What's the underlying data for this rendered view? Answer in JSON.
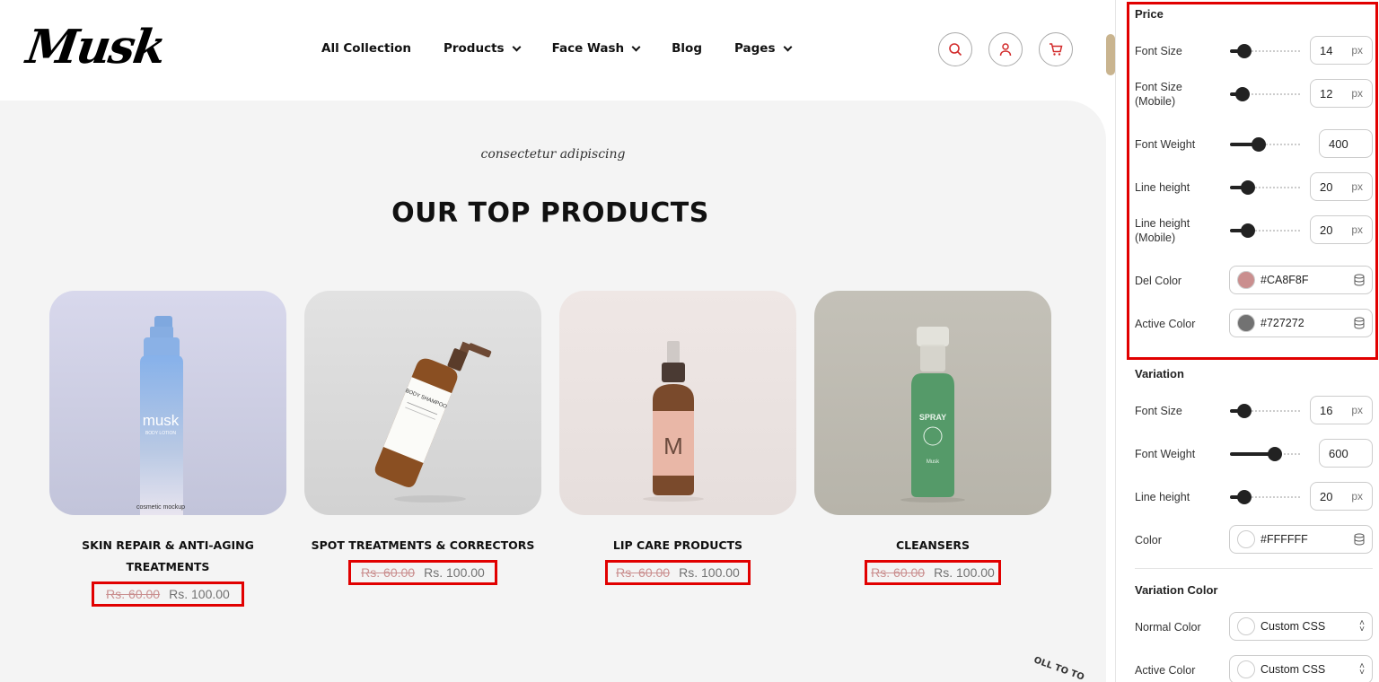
{
  "store": {
    "logo": "Musk",
    "nav": [
      {
        "label": "All Collection",
        "has_dropdown": false
      },
      {
        "label": "Products",
        "has_dropdown": true
      },
      {
        "label": "Face Wash",
        "has_dropdown": true
      },
      {
        "label": "Blog",
        "has_dropdown": false
      },
      {
        "label": "Pages",
        "has_dropdown": true
      }
    ],
    "header_icons": [
      "search-icon",
      "user-icon",
      "cart-icon"
    ],
    "section_subtitle": "consectetur adipiscing",
    "section_title": "OUR TOP PRODUCTS",
    "products": [
      {
        "name": "SKIN REPAIR & ANTI-AGING TREATMENTS",
        "old_price": "Rs. 60.00",
        "price": "Rs. 100.00",
        "image_bg": "#c9cbe0",
        "bottle_label": "musk",
        "bottle_sub": "BODY LOTION",
        "bottle_brand": "cosmetic mockup"
      },
      {
        "name": "SPOT TREATMENTS & CORRECTORS",
        "old_price": "Rs. 60.00",
        "price": "Rs. 100.00",
        "image_bg": "#dcdcdc",
        "bottle_label": "BODY SHAMPOO"
      },
      {
        "name": "LIP CARE PRODUCTS",
        "old_price": "Rs. 60.00",
        "price": "Rs. 100.00",
        "image_bg": "#ece4e2",
        "bottle_label": "M"
      },
      {
        "name": "CLEANSERS",
        "old_price": "Rs. 60.00",
        "price": "Rs. 100.00",
        "image_bg": "#bfbcb2",
        "bottle_label": "SPRAY",
        "bottle_sub": "Musk"
      }
    ],
    "scroll_top_label": "OLL TO TO"
  },
  "panel": {
    "price": {
      "title": "Price",
      "font_size": {
        "label": "Font Size",
        "value": "14",
        "unit": "px",
        "level": 0.2
      },
      "font_size_mobile": {
        "label": "Font Size (Mobile)",
        "value": "12",
        "unit": "px",
        "level": 0.18
      },
      "font_weight": {
        "label": "Font Weight",
        "value": "400",
        "level": 0.4
      },
      "line_height": {
        "label": "Line height",
        "value": "20",
        "unit": "px",
        "level": 0.25
      },
      "line_height_mobile": {
        "label": "Line height (Mobile)",
        "value": "20",
        "unit": "px",
        "level": 0.25
      },
      "del_color": {
        "label": "Del Color",
        "value": "#CA8F8F"
      },
      "active_color": {
        "label": "Active Color",
        "value": "#727272"
      }
    },
    "variation": {
      "title": "Variation",
      "font_size": {
        "label": "Font Size",
        "value": "16",
        "unit": "px",
        "level": 0.2
      },
      "font_weight": {
        "label": "Font Weight",
        "value": "600",
        "level": 0.62
      },
      "line_height": {
        "label": "Line height",
        "value": "20",
        "unit": "px",
        "level": 0.2
      },
      "color": {
        "label": "Color",
        "value": "#FFFFFF"
      }
    },
    "variation_color": {
      "title": "Variation Color",
      "normal_color": {
        "label": "Normal Color",
        "value": "Custom CSS"
      },
      "active_color": {
        "label": "Active Color",
        "value": "Custom CSS"
      }
    }
  },
  "colors": {
    "highlight": "#e10000",
    "accent_icon": "#d22b2b",
    "scroll_knob": "#c9b48f"
  }
}
